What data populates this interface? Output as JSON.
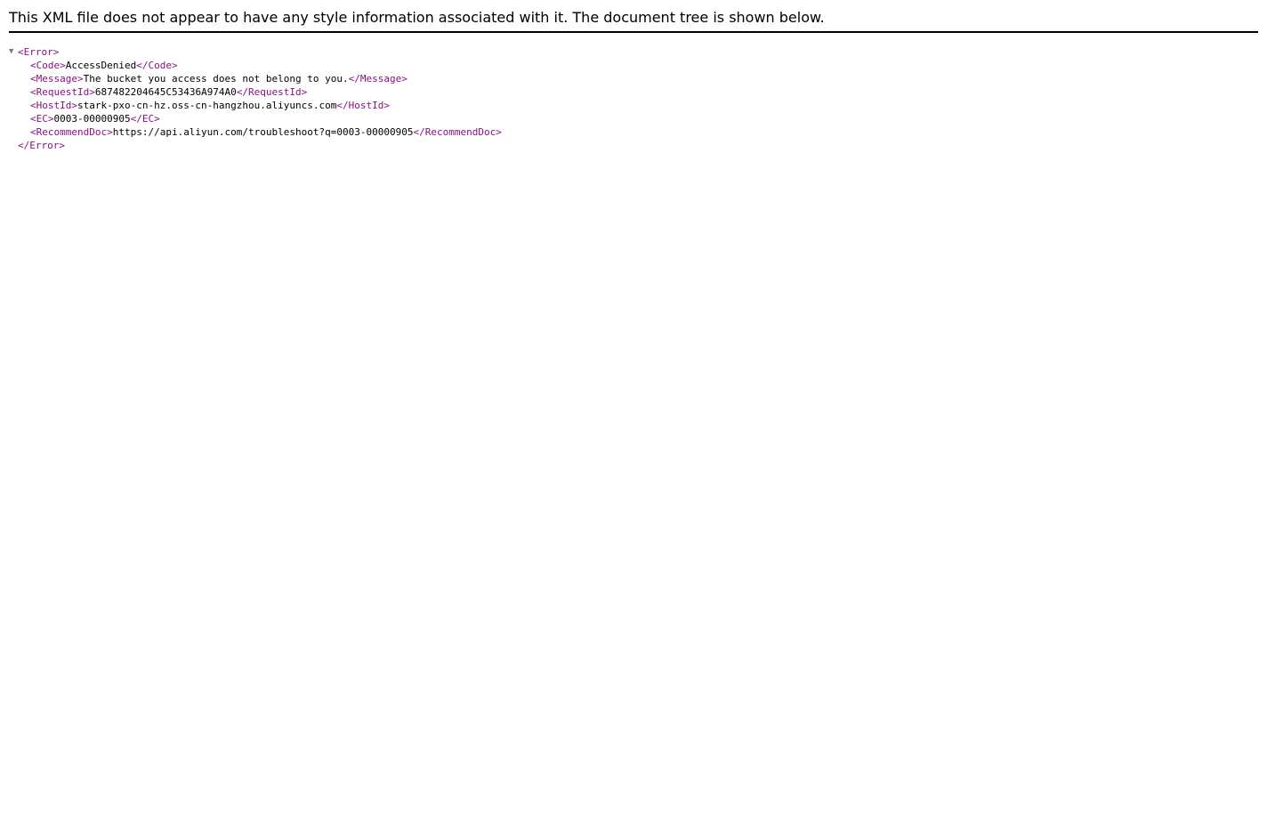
{
  "notice": "This XML file does not appear to have any style information associated with it. The document tree is shown below.",
  "toggle_glyph": "▼",
  "root": {
    "open_tag": "<Error>",
    "close_tag": "</Error>"
  },
  "children": [
    {
      "open": "<Code>",
      "value": "AccessDenied",
      "close": "</Code>"
    },
    {
      "open": "<Message>",
      "value": "The bucket you access does not belong to you.",
      "close": "</Message>"
    },
    {
      "open": "<RequestId>",
      "value": "687482204645C53436A974A0",
      "close": "</RequestId>"
    },
    {
      "open": "<HostId>",
      "value": "stark-pxo-cn-hz.oss-cn-hangzhou.aliyuncs.com",
      "close": "</HostId>"
    },
    {
      "open": "<EC>",
      "value": "0003-00000905",
      "close": "</EC>"
    },
    {
      "open": "<RecommendDoc>",
      "value": "https://api.aliyun.com/troubleshoot?q=0003-00000905",
      "close": "</RecommendDoc>"
    }
  ],
  "colors": {
    "tag": "#881280",
    "text": "#000000",
    "toggle": "#7a7a7a",
    "rule": "#000000"
  }
}
